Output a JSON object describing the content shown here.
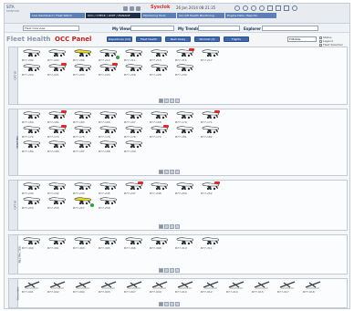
{
  "app": {
    "brand": "SITA",
    "brand_sub": "MONITOR",
    "clock": "Sysclok",
    "date": "26 Jan 2014 08:21:35",
    "tabs": [
      {
        "label": "Live Dashboard / Fleet Watch",
        "active": false
      },
      {
        "label": "OCC / CHECK / LIMIT / MANAGE",
        "active": true
      },
      {
        "label": "Monitoring Tools",
        "active": false
      },
      {
        "label": "Aircraft Health Monitoring",
        "active": false
      },
      {
        "label": "Engine Data / Reports",
        "active": false
      }
    ]
  },
  "filters": {
    "view_label": "Fleet Overview",
    "my_views_label": "My Views",
    "my_trends_label": "My Trends",
    "explorer_label": "Explorer"
  },
  "header": {
    "title_fleet": "Fleet Health",
    "title_occ": "OCC Panel",
    "buttons": [
      "Departures (14)",
      "Fleet Health",
      "Next Delay",
      "Worklist (3)",
      "Flights"
    ],
    "fleet_select": "F:Mobile",
    "options": [
      "Status",
      "Legend",
      "Fleet Selection",
      "Legend"
    ]
  },
  "sections": [
    {
      "label": "CAT III",
      "aircraft": [
        {
          "reg": "B77-202",
          "state": "normal"
        },
        {
          "reg": "B77-204",
          "state": "normal"
        },
        {
          "reg": "B77-206",
          "state": "highlight"
        },
        {
          "reg": "B77-210",
          "state": "dot"
        },
        {
          "reg": "B77-211",
          "state": "normal"
        },
        {
          "reg": "B77-213",
          "state": "normal"
        },
        {
          "reg": "B77-215",
          "state": "alert"
        },
        {
          "reg": "B77-217",
          "state": "normal"
        },
        {
          "reg": "B77-220",
          "state": "normal"
        },
        {
          "reg": "B77-221",
          "state": "alert"
        },
        {
          "reg": "B77-223",
          "state": "normal"
        },
        {
          "reg": "B77-224",
          "state": "alert"
        },
        {
          "reg": "B77-226",
          "state": "normal"
        },
        {
          "reg": "B77-228",
          "state": "normal"
        },
        {
          "reg": "B77-230",
          "state": "normal"
        }
      ]
    },
    {
      "label": "VERIFIED",
      "aircraft": [
        {
          "reg": "B77-160",
          "state": "normal"
        },
        {
          "reg": "B77-161",
          "state": "alert"
        },
        {
          "reg": "B77-163",
          "state": "normal"
        },
        {
          "reg": "B77-165",
          "state": "normal"
        },
        {
          "reg": "B77-167",
          "state": "normal"
        },
        {
          "reg": "B77-168",
          "state": "normal"
        },
        {
          "reg": "B77-170",
          "state": "normal"
        },
        {
          "reg": "B77-171",
          "state": "alert"
        },
        {
          "reg": "B77-172",
          "state": "normal"
        },
        {
          "reg": "B77-174",
          "state": "alert"
        },
        {
          "reg": "B77-175",
          "state": "normal"
        },
        {
          "reg": "B77-176",
          "state": "normal"
        },
        {
          "reg": "B77-178",
          "state": "normal"
        },
        {
          "reg": "B77-179",
          "state": "alert"
        },
        {
          "reg": "B77-181",
          "state": "normal"
        },
        {
          "reg": "B77-182",
          "state": "normal"
        },
        {
          "reg": "B77-184",
          "state": "normal"
        },
        {
          "reg": "B77-185",
          "state": "normal"
        },
        {
          "reg": "B77-187",
          "state": "normal"
        },
        {
          "reg": "B77-188",
          "state": "normal"
        },
        {
          "reg": "B77-190",
          "state": "normal"
        }
      ]
    },
    {
      "label": "CAT III",
      "aircraft": [
        {
          "reg": "B77-240",
          "state": "normal"
        },
        {
          "reg": "B77-242",
          "state": "normal"
        },
        {
          "reg": "B77-243",
          "state": "normal"
        },
        {
          "reg": "B77-245",
          "state": "normal"
        },
        {
          "reg": "B77-247",
          "state": "alert"
        },
        {
          "reg": "B77-248",
          "state": "normal"
        },
        {
          "reg": "B77-250",
          "state": "normal"
        },
        {
          "reg": "B77-252",
          "state": "alert"
        },
        {
          "reg": "B77-253",
          "state": "normal"
        },
        {
          "reg": "B77-255",
          "state": "normal"
        },
        {
          "reg": "B77-257",
          "state": "highlight-dot"
        },
        {
          "reg": "B77-258",
          "state": "normal"
        }
      ]
    },
    {
      "label": "RESTRICTED",
      "aircraft": [
        {
          "reg": "B77-300",
          "state": "normal"
        },
        {
          "reg": "B77-301",
          "state": "normal"
        },
        {
          "reg": "B77-303",
          "state": "normal"
        },
        {
          "reg": "B77-305",
          "state": "normal"
        },
        {
          "reg": "B77-306",
          "state": "normal"
        },
        {
          "reg": "B77-308",
          "state": "normal"
        },
        {
          "reg": "B77-310",
          "state": "normal"
        },
        {
          "reg": "B77-311",
          "state": "normal"
        }
      ]
    },
    {
      "label": "Grounded",
      "aircraft": [
        {
          "reg": "B77-001",
          "state": "grounded"
        },
        {
          "reg": "B77-002",
          "state": "grounded"
        },
        {
          "reg": "B77-004",
          "state": "grounded"
        },
        {
          "reg": "B77-005",
          "state": "grounded"
        },
        {
          "reg": "B77-007",
          "state": "grounded"
        },
        {
          "reg": "B77-009",
          "state": "grounded"
        },
        {
          "reg": "B77-010",
          "state": "grounded"
        },
        {
          "reg": "B77-012",
          "state": "grounded"
        },
        {
          "reg": "B77-014",
          "state": "grounded"
        },
        {
          "reg": "B77-015",
          "state": "grounded"
        },
        {
          "reg": "B77-017",
          "state": "grounded"
        },
        {
          "reg": "B77-018",
          "state": "grounded"
        }
      ]
    }
  ],
  "colors": {
    "accent": "#3f69ad",
    "alert": "#d92b2b",
    "ok": "#2f9e3d",
    "highlight": "#f1e221"
  }
}
